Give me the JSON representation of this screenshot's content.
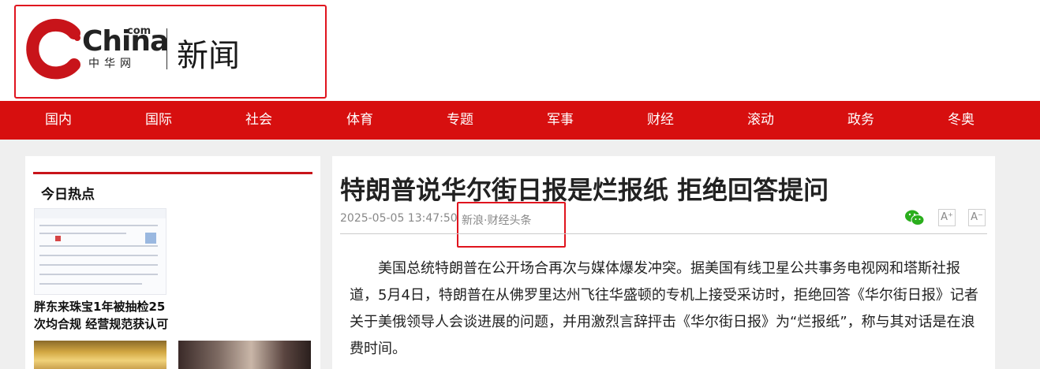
{
  "header": {
    "logo": {
      "com": "com",
      "china": "China",
      "cn": "中华网",
      "section": "新闻"
    }
  },
  "nav": {
    "items": [
      "国内",
      "国际",
      "社会",
      "体育",
      "专题",
      "军事",
      "财经",
      "滚动",
      "政务",
      "冬奥"
    ]
  },
  "sidebar": {
    "title": "今日热点",
    "items": [
      {
        "caption": "胖东来珠宝1年被抽检25次均合规 经营规范获认可"
      }
    ]
  },
  "article": {
    "title": "特朗普说华尔街日报是烂报纸 拒绝回答提问",
    "date": "2025-05-05 13:47:50",
    "source": "新浪·财经头条",
    "font_increase_label": "A⁺",
    "font_decrease_label": "A⁻",
    "share_icon": "wechat-icon",
    "body": "美国总统特朗普在公开场合再次与媒体爆发冲突。据美国有线卫星公共事务电视网和塔斯社报道，5月4日，特朗普在从佛罗里达州飞往华盛顿的专机上接受采访时，拒绝回答《华尔街日报》记者关于美俄领导人会谈进展的问题，并用激烈言辞抨击《华尔街日报》为“烂报纸”，称与其对话是在浪费时间。"
  },
  "colors": {
    "brand_red": "#d70f0f",
    "highlight_red": "#e0141e",
    "wechat_green": "#2aae1c"
  }
}
